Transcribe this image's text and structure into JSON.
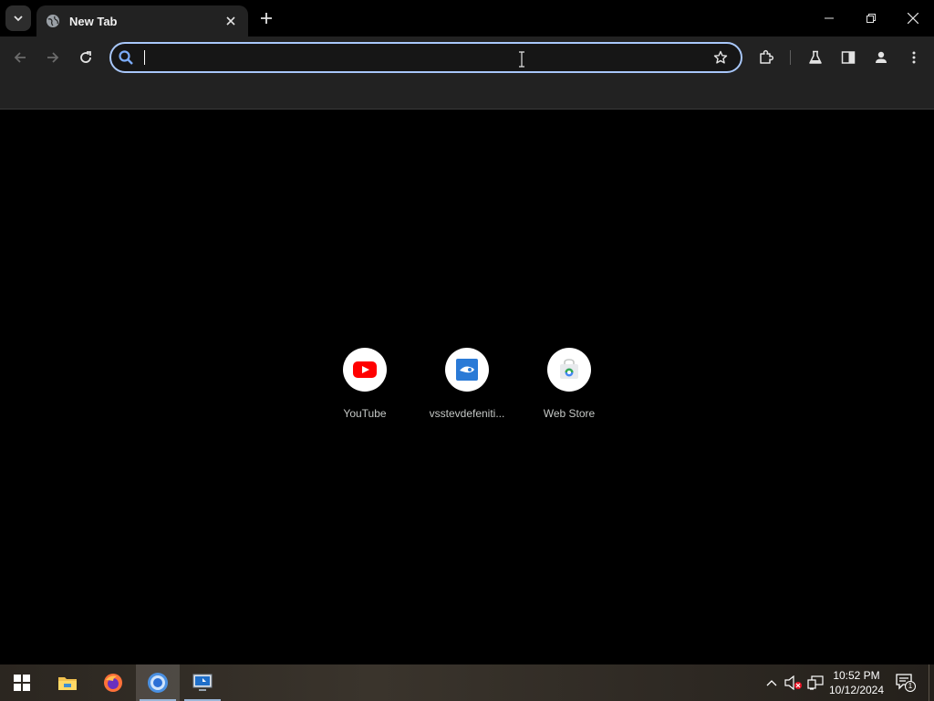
{
  "browser": {
    "tab": {
      "title": "New Tab"
    },
    "omnibox": {
      "value": "",
      "placeholder": ""
    }
  },
  "shortcuts": [
    {
      "label": "YouTube",
      "icon": "youtube-icon"
    },
    {
      "label": "vsstevdefeniti...",
      "icon": "vsstevdefeniti-site-icon"
    },
    {
      "label": "Web Store",
      "icon": "web-store-icon"
    }
  ],
  "taskbar": {
    "time": "10:52 PM",
    "date": "10/12/2024",
    "notification_count": "1",
    "apps": [
      "start-icon",
      "file-explorer-icon",
      "firefox-icon",
      "chrome-icon",
      "remote-desktop-icon"
    ]
  },
  "colors": {
    "omnibox_focus": "#a8c7fa",
    "toolbar_bg": "#222222",
    "youtube_red": "#ff0000",
    "accent_blue": "#2a7ad6"
  }
}
